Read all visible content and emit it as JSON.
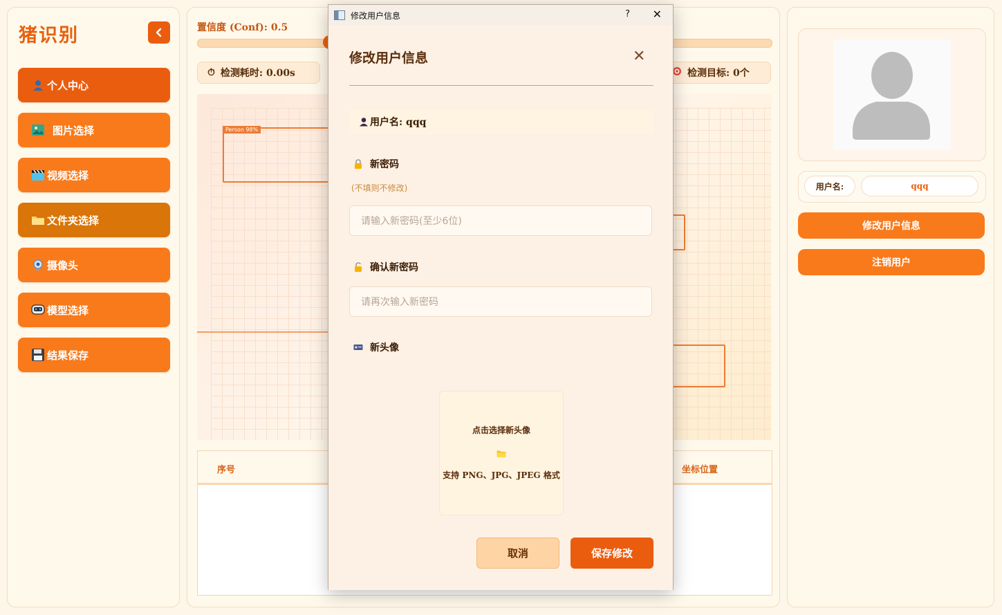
{
  "sidebar": {
    "title": "猪识别",
    "items": [
      {
        "label": "个人中心",
        "icon": "user-icon"
      },
      {
        "label": "图片选择",
        "icon": "image-icon"
      },
      {
        "label": "视频选择",
        "icon": "clapperboard-icon"
      },
      {
        "label": "文件夹选择",
        "icon": "folder-icon"
      },
      {
        "label": "摄像头",
        "icon": "webcam-icon"
      },
      {
        "label": "模型选择",
        "icon": "model-icon"
      },
      {
        "label": "结果保存",
        "icon": "floppy-icon"
      }
    ]
  },
  "main": {
    "conf_label": "置信度 (Conf): 0.5",
    "conf_value": 0.5,
    "stat_time": "检测耗时: 0.00s",
    "stat_targets": "检测目标: 0个",
    "detection_tag": "Person 98%",
    "table_headers": [
      "序号",
      "坐标位置"
    ]
  },
  "right": {
    "username_label": "用户名:",
    "username_value": "qqq",
    "edit_button": "修改用户信息",
    "logout_button": "注销用户"
  },
  "dialog": {
    "window_title": "修改用户信息",
    "help": "?",
    "heading": "修改用户信息",
    "username_line": "用户名: qqq",
    "new_password_label": "新密码",
    "new_password_hint": "(不填则不修改)",
    "new_password_placeholder": "请输入新密码(至少6位)",
    "confirm_password_label": "确认新密码",
    "confirm_password_placeholder": "请再次输入新密码",
    "new_avatar_label": "新头像",
    "upload_title": "点击选择新头像",
    "upload_formats": "支持 PNG、JPG、JPEG 格式",
    "cancel": "取消",
    "save": "保存修改"
  },
  "colors": {
    "accent": "#f97a1a",
    "accent_dark": "#ea5d0f",
    "background": "#fdf6e9"
  }
}
